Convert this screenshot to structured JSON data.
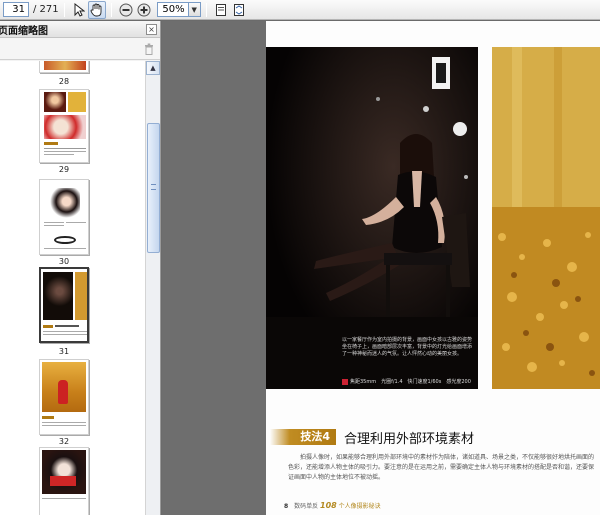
{
  "toolbar": {
    "page_number": "31",
    "page_total": "/ 271",
    "zoom_value": "50%"
  },
  "sidebar": {
    "title": "页面缩略图",
    "close_glyph": "×",
    "thumbnails": [
      {
        "label": "28",
        "selected": false
      },
      {
        "label": "29",
        "selected": false
      },
      {
        "label": "30",
        "selected": false
      },
      {
        "label": "31",
        "selected": true
      },
      {
        "label": "32",
        "selected": false
      }
    ]
  },
  "document": {
    "caption": "以一家餐厅作为室内拍摄的背景，画面中女孩以古雅的姿势坐在椅子上，画面暗部层次丰富，背景中的灯光给画面增添了一种神秘而迷人的气氛。让人怦然心动的美丽女孩。",
    "spec": "焦距35mm　光圈f/1.4　快门速度1/60s　感光度200",
    "technique_badge": "技法4",
    "technique_title": "合理利用外部环境素材",
    "body": "拍摄人像时，如果能够合理利用外部环境中的素材作为陪体，诸如道具、场景之类，不仅能够很好地烘托画面的色彩，还能增添人物主体的吸引力。要注意的是在运用之前，需要确定主体人物与环境素材的搭配是否和谐，还要保证画面中人物的主体地位不被动摇。",
    "footer_page": "8",
    "footer_series": "数码单反",
    "footer_number": "108",
    "footer_brand": "个人像摄影秘诀"
  },
  "colors": {
    "accent_gold": "#b07a12",
    "selection_border": "#3a3a3a",
    "scroll_blue": "#93aed3"
  }
}
